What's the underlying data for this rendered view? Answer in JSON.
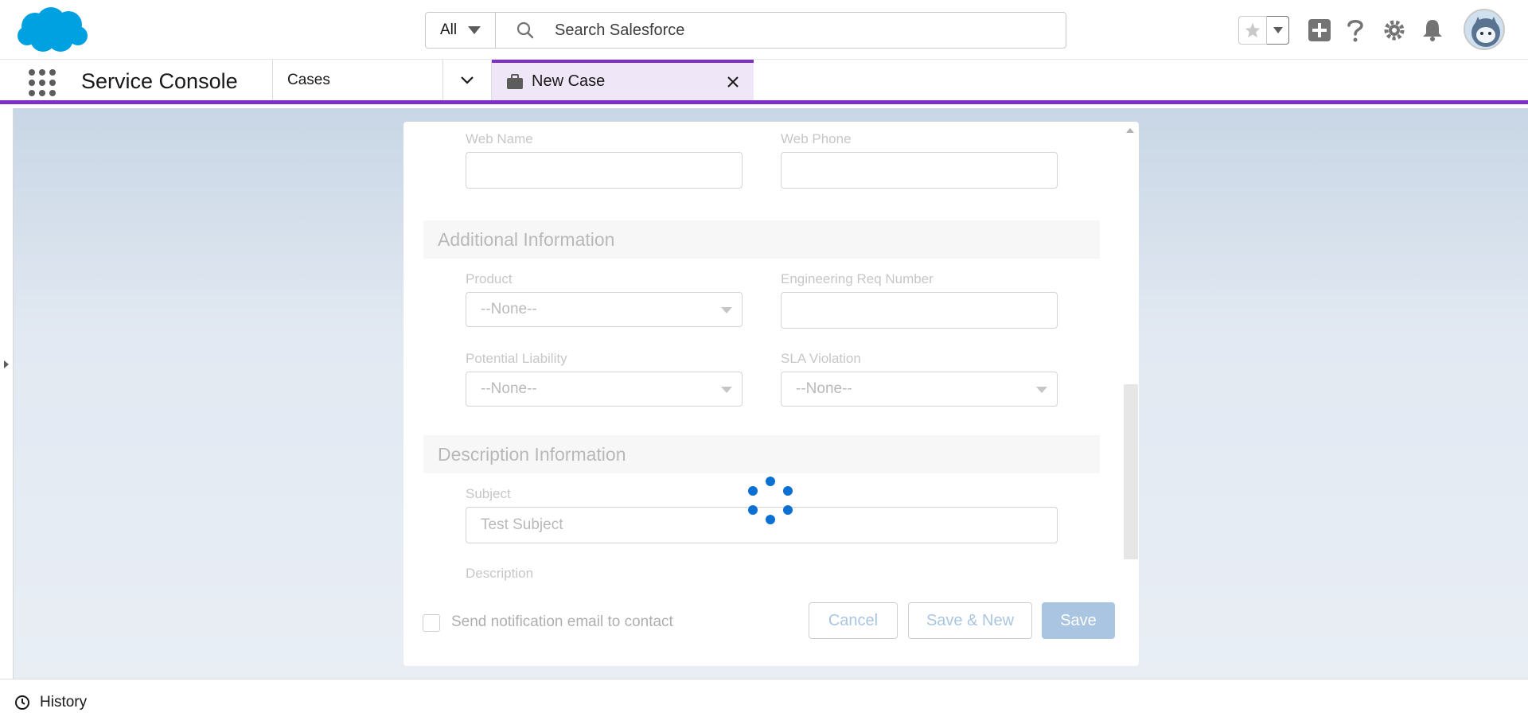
{
  "header": {
    "search_scope": "All",
    "search_placeholder": "Search Salesforce",
    "icons": [
      "salesforce-cloud-logo",
      "star-icon",
      "chevron-down-icon",
      "plus-icon",
      "help-icon",
      "setup-gear-icon",
      "bell-icon",
      "avatar"
    ]
  },
  "nav": {
    "app_name": "Service Console",
    "object_tab": "Cases",
    "workspace_tab": "New Case",
    "accent_color": "#7f2fc7"
  },
  "form": {
    "web_name_label": "Web Name",
    "web_phone_label": "Web Phone",
    "web_name_value": "",
    "web_phone_value": "",
    "section_additional": "Additional Information",
    "product_label": "Product",
    "product_value": "--None--",
    "eng_req_label": "Engineering Req Number",
    "eng_req_value": "",
    "liability_label": "Potential Liability",
    "liability_value": "--None--",
    "sla_label": "SLA Violation",
    "sla_value": "--None--",
    "section_description": "Description Information",
    "subject_label": "Subject",
    "subject_value": "Test Subject",
    "description_label": "Description"
  },
  "footer": {
    "notify_label": "Send notification email to contact",
    "notify_checked": false,
    "cancel_label": "Cancel",
    "save_new_label": "Save & New",
    "save_label": "Save"
  },
  "utility": {
    "history_label": "History"
  },
  "state": {
    "loading": true,
    "spinner_color": "#0b6fd4"
  }
}
